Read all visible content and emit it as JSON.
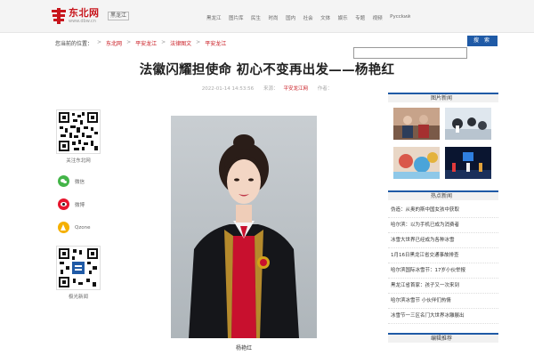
{
  "site": {
    "name": "东北网",
    "url": "www.dbw.cn",
    "region": "黑龙江",
    "brand_color": "#c8161d"
  },
  "nav": {
    "items": [
      "黑龙江",
      "图片库",
      "民生",
      "时尚",
      "国内",
      "社会",
      "文体",
      "娱乐",
      "专题",
      "视频",
      "Pycckий"
    ]
  },
  "breadcrumb": {
    "prefix": "您当前的位置：",
    "items": [
      "东北网",
      "平安龙江",
      "法律图文",
      "平安龙江"
    ]
  },
  "search": {
    "button_label": "搜 索",
    "value": ""
  },
  "article": {
    "title": "法徽闪耀担使命 初心不变再出发——杨艳红",
    "date": "2022-01-14 14:53:56",
    "source_label": "来源：",
    "source": "平安龙江网",
    "author_label": "作者："
  },
  "share": {
    "follow_label": "关注东北网",
    "buttons": [
      {
        "label": "微信",
        "icon": "wechat-icon",
        "color": "#44b549"
      },
      {
        "label": "微博",
        "icon": "weibo-icon",
        "color": "#e6162d"
      },
      {
        "label": "Qzone",
        "icon": "qzone-icon",
        "color": "#f5b000"
      }
    ],
    "app_label": "极光新闻"
  },
  "photo": {
    "caption": "杨艳红"
  },
  "sidebar": {
    "photo_news_title": "图片新闻",
    "hot_news_title": "热点新闻",
    "bottom_title": "编辑推荐",
    "hot_news": [
      "伪造：从奥的斯中国女孩中获取",
      "哈尔滨：以为手机已成为消费者",
      "冰雪大世界已经成为各种冰雪",
      "1月16日黑龙江省交通事故排查",
      "哈尔滨国际冰雪节：17岁小伙举报",
      "黑龙江省首家：孩子又一次来到",
      "哈尔滨冰雪节 小伙伴们热情",
      "冰雪节一三区名门大世界冰雕展出"
    ]
  }
}
